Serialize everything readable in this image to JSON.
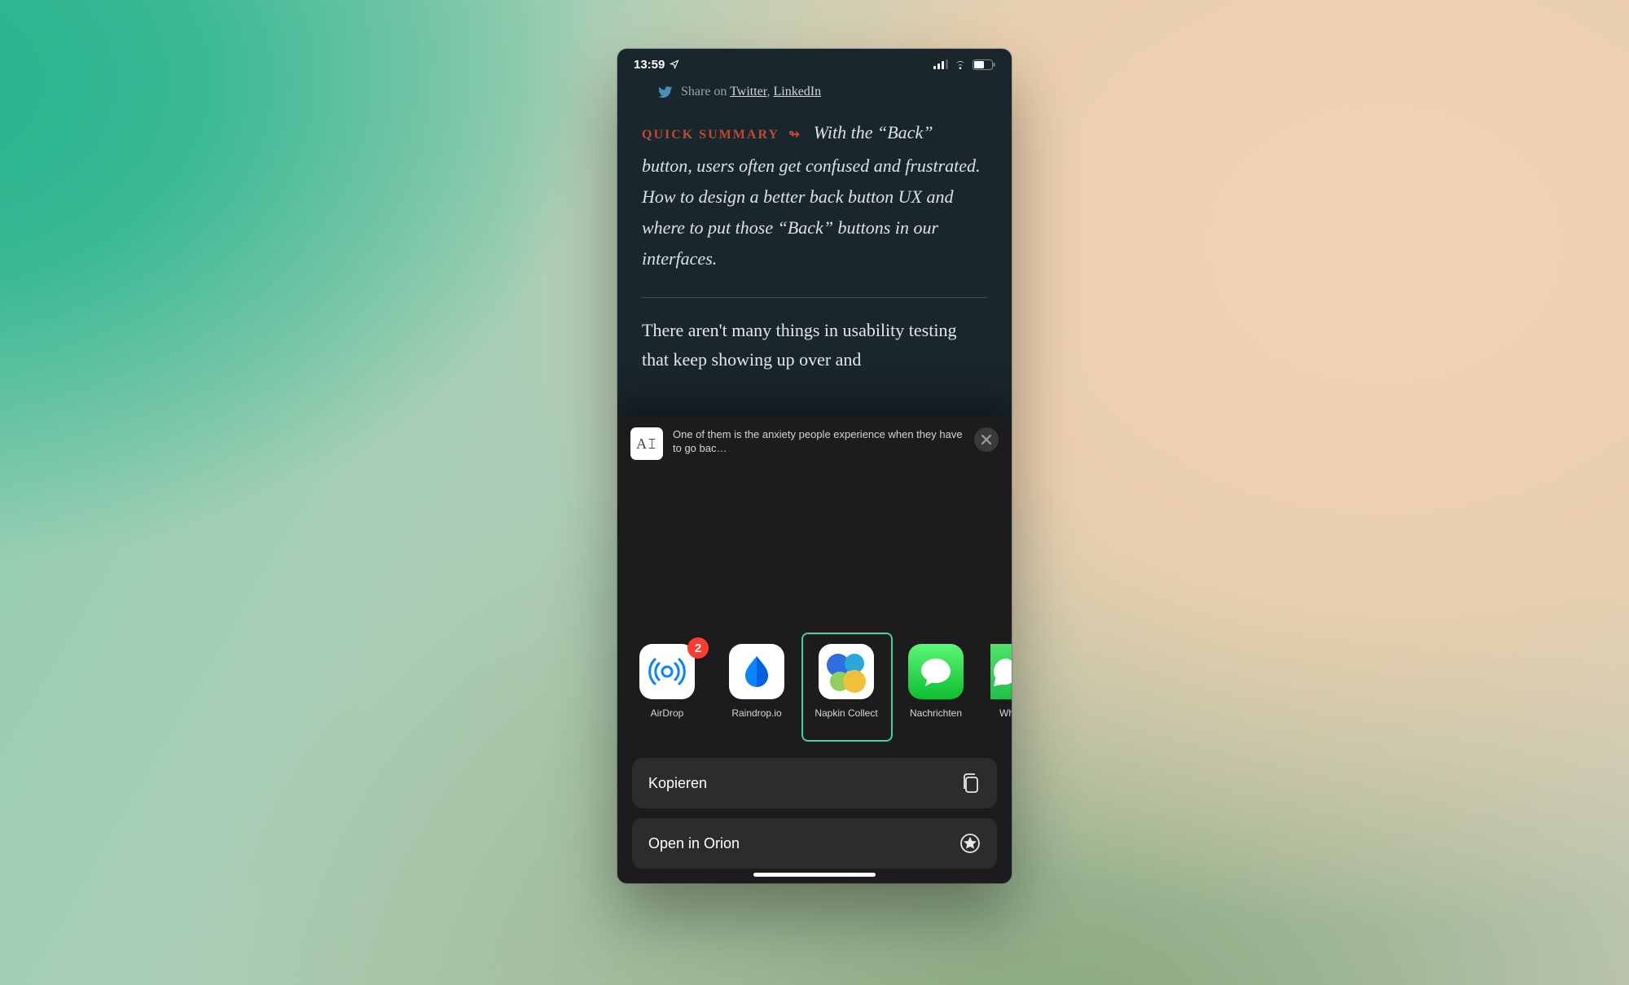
{
  "status": {
    "time": "13:59",
    "location_glyph": "↗",
    "signal_bars": 3,
    "wifi": true,
    "battery_pct": 55
  },
  "article": {
    "share_prefix": "Share on ",
    "share_links": [
      "Twitter",
      "LinkedIn"
    ],
    "quick_summary_label": "QUICK SUMMARY",
    "quick_summary_deco": "↬",
    "quick_summary_text": "With the “Back” button, users often get confused and frustrated. How to design a better back button UX and where to put those “Back” buttons in our interfaces.",
    "body_visible": "There aren't many things in usability testing that keep showing up over and"
  },
  "sheet": {
    "thumb_glyph": "A𝙸",
    "preview_text": "One of them is the anxiety people experience when they have to go bac…",
    "apps": [
      {
        "name": "AirDrop",
        "icon": "airdrop",
        "badge": "2"
      },
      {
        "name": "Raindrop.io",
        "icon": "raindrop",
        "badge": null
      },
      {
        "name": "Napkin Collect",
        "icon": "napkin",
        "badge": null,
        "highlighted": true
      },
      {
        "name": "Nachrichten",
        "icon": "messages",
        "badge": null
      },
      {
        "name": "Wh",
        "icon": "whatsapp",
        "badge": null,
        "partial": true
      }
    ],
    "actions": [
      {
        "label": "Kopieren",
        "icon": "copy"
      },
      {
        "label": "Open in Orion",
        "icon": "orion"
      }
    ]
  }
}
